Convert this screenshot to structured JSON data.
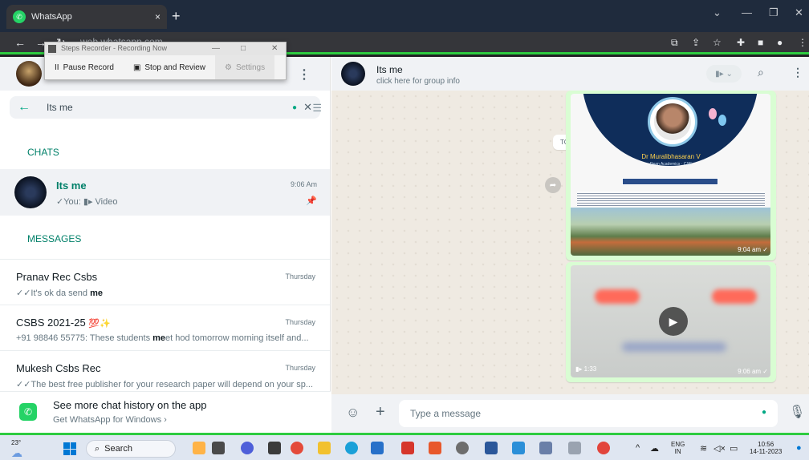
{
  "browser": {
    "tab_title": "WhatsApp",
    "tab_close": "×",
    "new_tab": "+",
    "url": "web.whatsapp.com"
  },
  "recorder": {
    "title": "Steps Recorder - Recording Now",
    "pause": "Pause Record",
    "stop": "Stop and Review",
    "settings": "Settings"
  },
  "search": {
    "value": "Its me"
  },
  "sidebar": {
    "chats_label": "CHATS",
    "messages_label": "MESSAGES",
    "chat": {
      "name": "Its me",
      "preview": "✓You: ▮▸ Video",
      "time": "9:06 Am"
    },
    "messages": [
      {
        "name": "Pranav Rec Csbs",
        "time": "Thursday",
        "pre": "✓✓It's ok da send ",
        "match": "me",
        "post": "",
        "emoji": ""
      },
      {
        "name": "CSBS 2021-25 ",
        "time": "Thursday",
        "pre": "+91 98846 55775: These students ",
        "match": "me",
        "post": "et hod tomorrow morning itself and...",
        "emoji": "💯✨"
      },
      {
        "name": "Mukesh Csbs Rec",
        "time": "Thursday",
        "pre": "✓✓The best free publisher for your research paper will depend on your sp...",
        "match": "",
        "post": "",
        "emoji": ""
      }
    ],
    "promo_title": "See more chat history on the app",
    "promo_sub": "Get WhatsApp for Windows  ›"
  },
  "conversation": {
    "title": "Its me",
    "subtitle": "click here for group info",
    "date_chip": "TODAY",
    "poster_name": "Dr Muralibhasaran V",
    "poster_desig": "Dean Academics · CSE",
    "image_time": "9:04 am ✓",
    "video_duration": "▮▸ 1:33",
    "video_time": "9:06 am ✓",
    "composer_placeholder": "Type a message"
  },
  "taskbar": {
    "weather_temp": "23°",
    "search_label": "Search",
    "lang_top": "ENG",
    "lang_bottom": "IN",
    "time": "10:56",
    "date": "14-11-2023"
  },
  "icons": {
    "video_call": "video-icon",
    "search": "search-icon",
    "menu": "menu-dots-icon",
    "emoji": "emoji-icon",
    "attach": "plus-icon",
    "mic": "mic-icon"
  },
  "colors": {
    "accent": "#00a884",
    "accent_dark": "#008069",
    "recording_border": "#2ecc40"
  }
}
